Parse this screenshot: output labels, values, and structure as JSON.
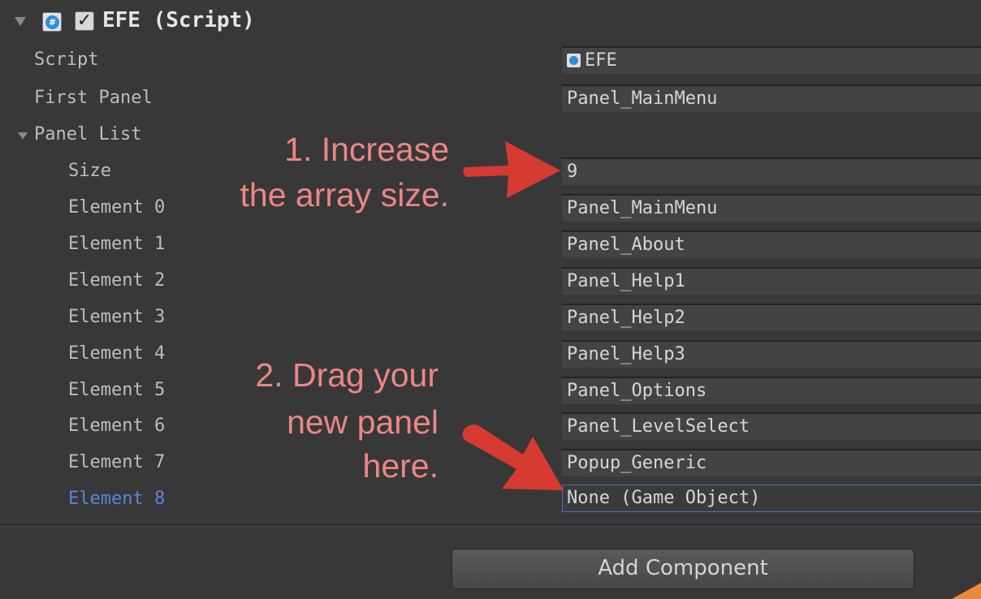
{
  "component": {
    "title": "EFE (Script)",
    "check_mark": "✓"
  },
  "rows": [
    {
      "label": "Script",
      "value": "EFE"
    },
    {
      "label": "First Panel",
      "value": "Panel_MainMenu"
    },
    {
      "label": "Panel List",
      "value": ""
    },
    {
      "label": "Size",
      "value": "9"
    },
    {
      "label": "Element 0",
      "value": "Panel_MainMenu"
    },
    {
      "label": "Element 1",
      "value": "Panel_About"
    },
    {
      "label": "Element 2",
      "value": "Panel_Help1"
    },
    {
      "label": "Element 3",
      "value": "Panel_Help2"
    },
    {
      "label": "Element 4",
      "value": "Panel_Help3"
    },
    {
      "label": "Element 5",
      "value": "Panel_Options"
    },
    {
      "label": "Element 6",
      "value": "Panel_LevelSelect"
    },
    {
      "label": "Element 7",
      "value": "Popup_Generic"
    },
    {
      "label": "Element 8",
      "value": "None (Game Object)"
    }
  ],
  "add_component_label": "Add Component",
  "annotations": {
    "step1_line1": "1. Increase",
    "step1_line2": "the array size.",
    "step2_line1": "2. Drag your",
    "step2_line2": "new panel",
    "step2_line3": "here."
  },
  "colors": {
    "background": "#383838",
    "field": "#434343",
    "selected_label": "#5b84d8",
    "annotation_text": "#ec8686",
    "arrow": "#d63b32"
  },
  "icons": {
    "foldout": "triangle-down",
    "script": "csharp-script-icon"
  }
}
